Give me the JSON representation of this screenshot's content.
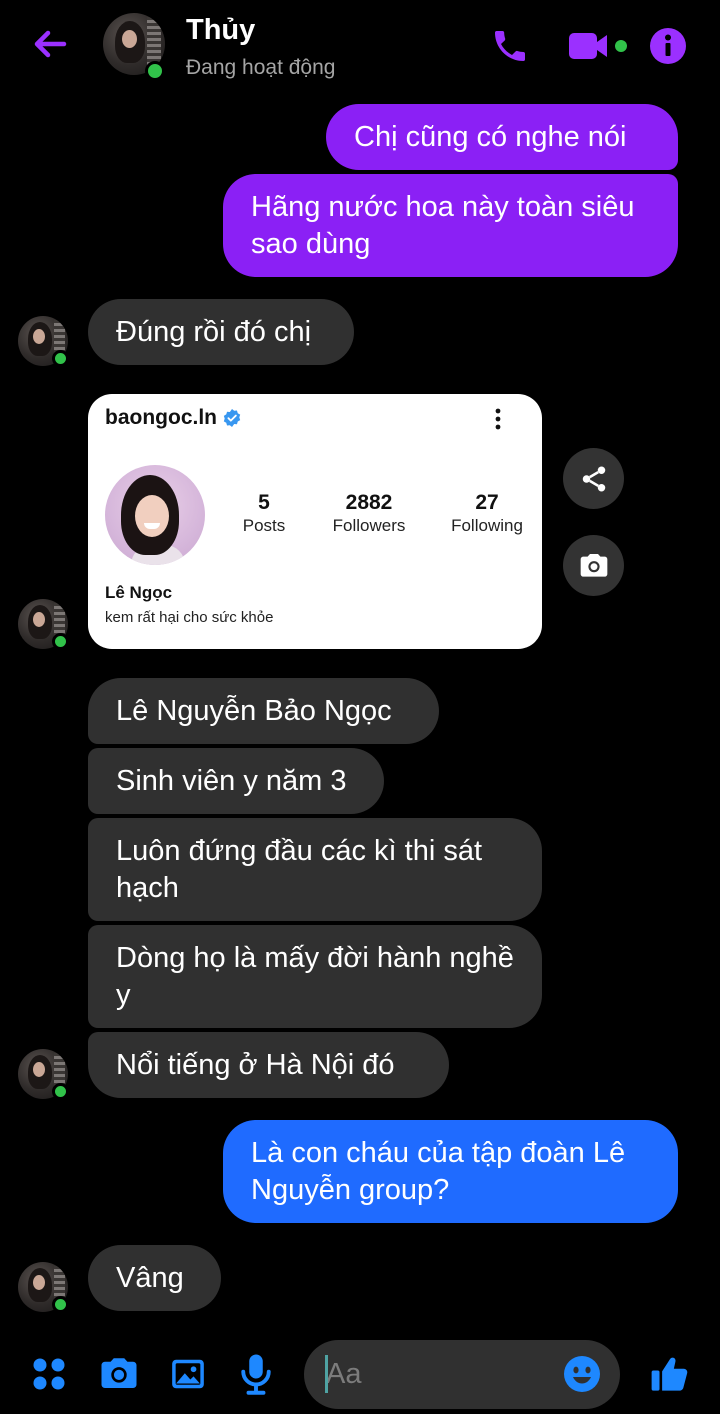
{
  "header": {
    "contact_name": "Thủy",
    "status": "Đang hoạt động"
  },
  "messages": [
    {
      "from": "me",
      "text": "Chị cũng có nghe nói"
    },
    {
      "from": "me",
      "text": "Hãng nước hoa này toàn siêu sao dùng"
    },
    {
      "from": "them",
      "text": "Đúng rồi đó chị"
    },
    {
      "from": "them",
      "type": "profile_card"
    },
    {
      "from": "them",
      "text": "Lê Nguyễn Bảo Ngọc"
    },
    {
      "from": "them",
      "text": "Sinh viên y năm 3"
    },
    {
      "from": "them",
      "text": "Luôn đứng đầu các kì thi sát hạch"
    },
    {
      "from": "them",
      "text": "Dòng họ là mấy đời hành nghề y"
    },
    {
      "from": "them",
      "text": "Nổi tiếng ở Hà Nội đó"
    },
    {
      "from": "me",
      "text": "Là con cháu của tập đoàn Lê Nguyễn group?"
    },
    {
      "from": "them",
      "text": "Vâng"
    }
  ],
  "profile_card": {
    "username": "baongoc.ln",
    "posts": "5",
    "posts_label": "Posts",
    "followers": "2882",
    "followers_label": "Followers",
    "following": "27",
    "following_label": "Following",
    "name": "Lê Ngọc",
    "bio": "kem rất hại cho sức khỏe"
  },
  "composer": {
    "placeholder": "Aa"
  },
  "colors": {
    "accent": "#8b20f5",
    "outgoing_bubble": "#8b20f5",
    "outgoing_bubble_blue": "#1f6bff",
    "incoming_bubble": "#303030",
    "online": "#31c24a",
    "composer_icons": "#1e88ff"
  },
  "icons": {
    "back": "back-arrow-icon",
    "call": "phone-icon",
    "video": "video-camera-icon",
    "info": "info-icon",
    "verified": "verified-badge-icon",
    "more": "more-vertical-icon",
    "share": "share-icon",
    "camera": "camera-icon",
    "apps": "apps-grid-icon",
    "gallery": "gallery-icon",
    "mic": "microphone-icon",
    "emoji": "emoji-icon",
    "like": "thumbs-up-icon"
  }
}
